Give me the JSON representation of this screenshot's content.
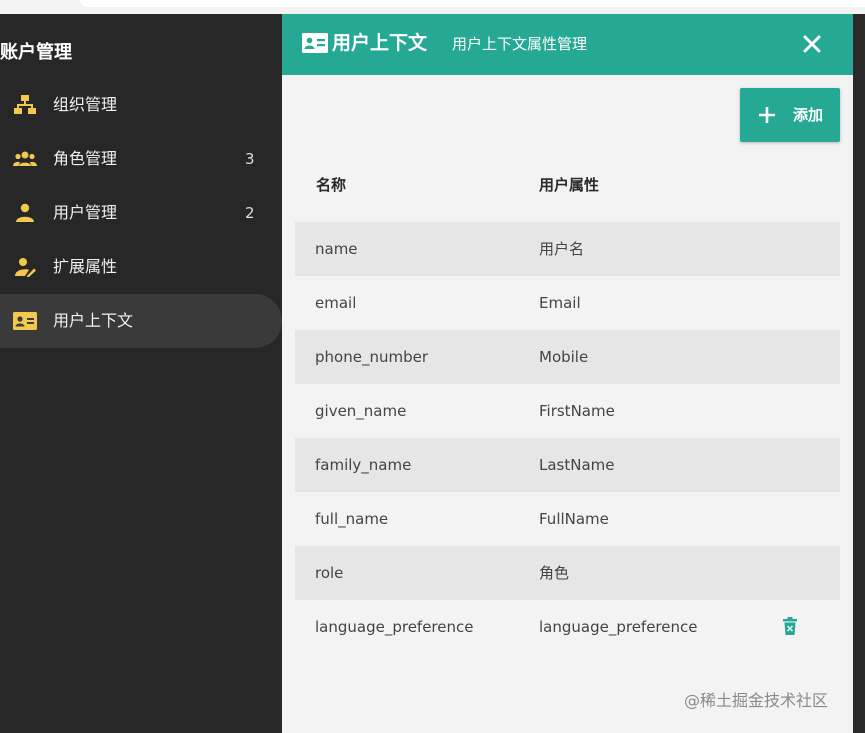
{
  "sidebar": {
    "title": "账户管理",
    "items": [
      {
        "icon": "org-tree-icon",
        "label": "组织管理",
        "count": ""
      },
      {
        "icon": "group-icon",
        "label": "角色管理",
        "count": "3"
      },
      {
        "icon": "person-icon",
        "label": "用户管理",
        "count": "2"
      },
      {
        "icon": "person-edit-icon",
        "label": "扩展属性",
        "count": ""
      },
      {
        "icon": "contact-card-icon",
        "label": "用户上下文",
        "count": "",
        "active": true
      }
    ]
  },
  "panel": {
    "title": "用户上下文",
    "subtitle": "用户上下文属性管理",
    "add_label": "添加",
    "columns": {
      "name": "名称",
      "attr": "用户属性"
    },
    "rows": [
      {
        "name": "name",
        "attr": "用户名"
      },
      {
        "name": "email",
        "attr": "Email"
      },
      {
        "name": "phone_number",
        "attr": "Mobile"
      },
      {
        "name": "given_name",
        "attr": "FirstName"
      },
      {
        "name": "family_name",
        "attr": "LastName"
      },
      {
        "name": "full_name",
        "attr": "FullName"
      },
      {
        "name": "role",
        "attr": "角色"
      },
      {
        "name": "language_preference",
        "attr": "language_preference",
        "deletable": true
      }
    ]
  },
  "watermark": "@稀土掘金技术社区",
  "colors": {
    "accent": "#25a894",
    "sidebar_bg": "#272727",
    "sidebar_icon": "#f2c94c",
    "panel_bg": "#f3f3f3",
    "row_shade": "#e6e6e6"
  }
}
